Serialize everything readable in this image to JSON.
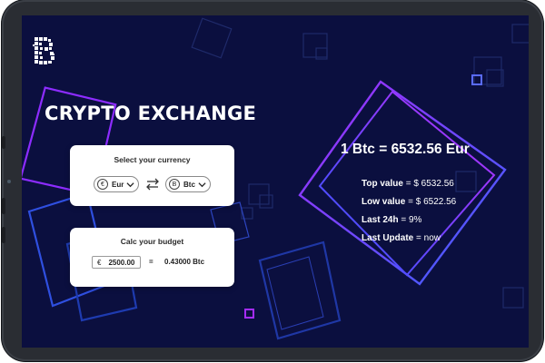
{
  "app": {
    "title": "CRYPTO EXCHANGE",
    "logo_icon": "blockchain-b-logo-icon"
  },
  "currency_card": {
    "title": "Select your currency",
    "from": {
      "symbol": "€",
      "label": "Eur"
    },
    "to": {
      "symbol": "B",
      "label": "Btc"
    },
    "swap_icon": "swap-arrows-icon",
    "chevron_icon": "chevron-down-icon"
  },
  "budget_card": {
    "title": "Calc your budget",
    "currency_symbol": "€",
    "amount": "2500.00",
    "equals": "=",
    "result": "0.43000 Btc"
  },
  "rate": {
    "headline": "1 Btc = 6532.56 Eur"
  },
  "stats": [
    {
      "label": "Top value",
      "value": " = $ 6532.56"
    },
    {
      "label": "Low value",
      "value": " = $ 6522.56"
    },
    {
      "label": "Last 24h",
      "value": " = 9%"
    },
    {
      "label": "Last Update",
      "value": " = now"
    }
  ],
  "colors": {
    "background": "#0b0f3f",
    "accent_purple": "#9b2bff",
    "accent_blue": "#3a5bff",
    "card": "#ffffff",
    "text": "#ffffff"
  }
}
